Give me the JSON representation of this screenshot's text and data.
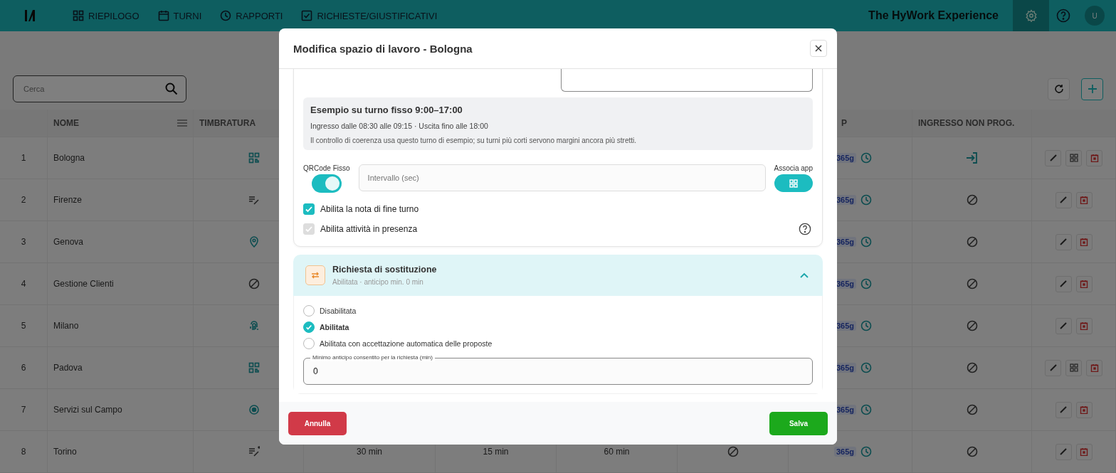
{
  "nav": {
    "items": [
      {
        "label": "RIEPILOGO",
        "kind": "grid"
      },
      {
        "label": "TURNI",
        "kind": "calendar"
      },
      {
        "label": "RAPPORTI",
        "kind": "clock"
      },
      {
        "label": "RICHIESTE/GIUSTIFICATIVI",
        "kind": "check"
      }
    ],
    "brand": "The HyWork Experience",
    "avatar": "U"
  },
  "search": {
    "placeholder": "Cerca"
  },
  "table": {
    "columns": {
      "nome": "NOME",
      "timbratura": "TIMBRATURA",
      "column_8": "P",
      "ingresso": "INGRESSO NON PROG."
    },
    "rows": [
      {
        "index": "1",
        "name": "Bologna",
        "timbratura": {
          "kind": "qr"
        },
        "badge": "365g",
        "ingresso": {
          "kind": "enter"
        },
        "actions": [
          {
            "kind": "edit"
          },
          {
            "kind": "qr"
          },
          {
            "kind": "delete"
          }
        ]
      },
      {
        "index": "2",
        "name": "Firenze",
        "timbratura": {
          "kind": "note"
        },
        "badge": "365g",
        "ingresso": {
          "kind": "ban"
        },
        "actions": [
          {
            "kind": "edit"
          },
          {
            "kind": "delete"
          }
        ]
      },
      {
        "index": "3",
        "name": "Genova",
        "timbratura": {
          "kind": "pin"
        },
        "badge": "365g",
        "ingresso": {
          "kind": "ban"
        },
        "actions": [
          {
            "kind": "edit"
          },
          {
            "kind": "delete"
          }
        ]
      },
      {
        "index": "4",
        "name": "Gestione Clienti",
        "timbratura": {
          "kind": "ban"
        },
        "badge": "365g",
        "ingresso": {
          "kind": "ban"
        },
        "actions": [
          {
            "kind": "edit"
          },
          {
            "kind": "delete"
          }
        ]
      },
      {
        "index": "5",
        "name": "Milano",
        "timbratura": {
          "kind": "fingerprint"
        },
        "badge": "365g",
        "ingresso": {
          "kind": "ban"
        },
        "actions": [
          {
            "kind": "edit"
          },
          {
            "kind": "delete"
          }
        ]
      },
      {
        "index": "6",
        "name": "Padova",
        "timbratura": {
          "kind": "qr"
        },
        "badge": "365g",
        "ingresso": {
          "kind": "ban"
        },
        "actions": [
          {
            "kind": "edit"
          },
          {
            "kind": "qr"
          },
          {
            "kind": "delete"
          }
        ]
      },
      {
        "index": "7",
        "name": "Servizi sul Campo",
        "timbratura": {
          "kind": "target"
        },
        "badge": "365g",
        "ingresso": {
          "kind": "ban"
        },
        "actions": [
          {
            "kind": "edit"
          },
          {
            "kind": "delete"
          }
        ]
      },
      {
        "index": "8",
        "name": "Torino",
        "timbratura": {
          "kind": "note_dot"
        },
        "column_4": "30 min",
        "column_5": "15 min",
        "column_6": "60 min",
        "column_7": {
          "kind": "ban"
        },
        "badge": "365g",
        "ingresso": {
          "kind": "ban"
        },
        "actions": [
          {
            "kind": "edit"
          },
          {
            "kind": "delete"
          }
        ]
      }
    ]
  },
  "modal": {
    "title": "Modifica spazio di lavoro - Bologna",
    "example": {
      "title": "Esempio su turno fisso 9:00–17:00",
      "line_1": "Ingresso dalle 08:30 alle 09:15 · Uscita fino alle 18:00",
      "line_2": "Il controllo di coerenza usa questo turno di esempio; su turni più corti servono margini ancora più stretti."
    },
    "qr_toggle": {
      "label": "QRCode Fisso",
      "on": true
    },
    "interval": {
      "placeholder": "Intervallo (sec)"
    },
    "associa": {
      "label": "Associa app"
    },
    "checkboxes": [
      {
        "label": "Abilita la nota di fine turno",
        "checked": true,
        "disabled": false
      },
      {
        "label": "Abilita attività in presenza",
        "checked": true,
        "disabled": true
      }
    ],
    "section": {
      "title": "Richiesta di sostituzione",
      "subtitle": "Abilitata · anticipo min. 0 min",
      "expanded": true,
      "options": [
        {
          "label": "Disabilitata",
          "selected": false
        },
        {
          "label": "Abilitata",
          "selected": true
        },
        {
          "label": "Abilitata con accettazione automatica delle proposte",
          "selected": false
        }
      ],
      "min_field": {
        "label": "Minimo anticipo consentito per la richiesta (min)",
        "value": "0"
      }
    },
    "buttons": {
      "cancel": "Annulla",
      "save": "Salva"
    }
  }
}
